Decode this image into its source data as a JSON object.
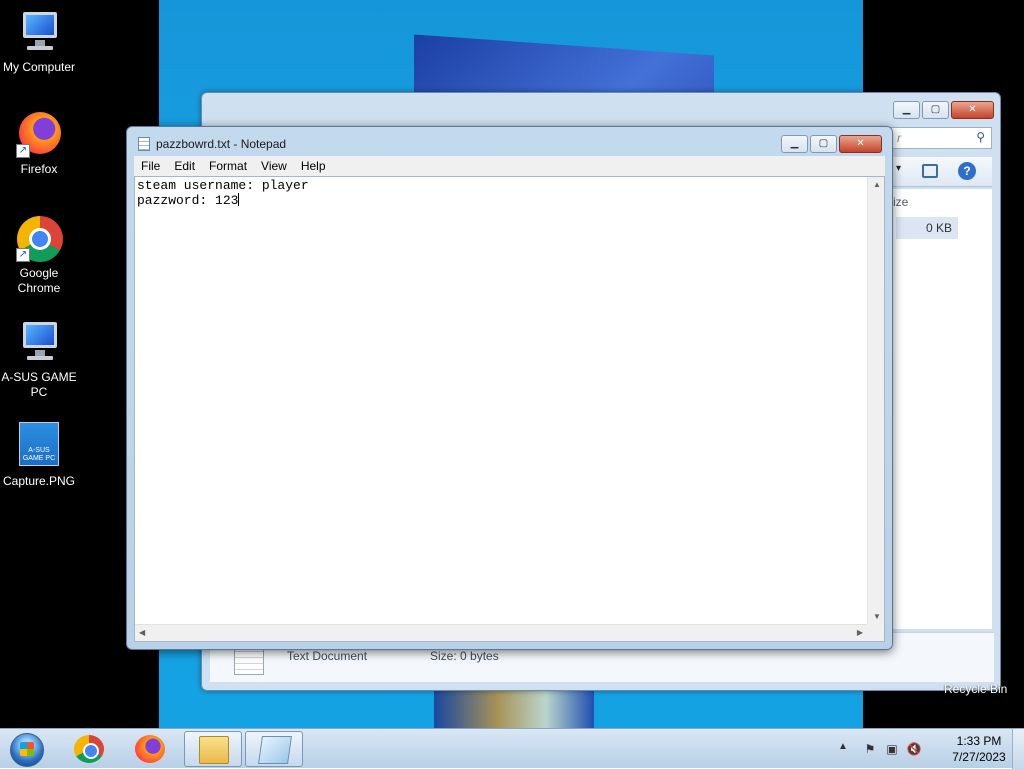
{
  "desktop": {
    "icons": [
      {
        "label_line1": "My Computer",
        "label_line2": ""
      },
      {
        "label_line1": "Firefox",
        "label_line2": ""
      },
      {
        "label_line1": "Google",
        "label_line2": "Chrome"
      },
      {
        "label_line1": "A-SUS GAME",
        "label_line2": "PC"
      },
      {
        "label_line1": "Capture.PNG",
        "label_line2": "",
        "thumb_text": "A-SUS GAME PC"
      }
    ],
    "recycle_bin_label": "Recycle Bin"
  },
  "explorer": {
    "search_placeholder_fragment": "r",
    "column_header_fragment": "ize",
    "file_size": "0 KB",
    "details": {
      "type": "Text Document",
      "size": "Size: 0 bytes"
    }
  },
  "notepad": {
    "title": "pazzbowrd.txt - Notepad",
    "menu": [
      "File",
      "Edit",
      "Format",
      "View",
      "Help"
    ],
    "lines": [
      "steam username: player",
      "pazzword: 123"
    ]
  },
  "taskbar": {
    "clock_time": "1:33 PM",
    "clock_date": "7/27/2023"
  },
  "icons": {
    "minimize": "minimize-icon",
    "maximize": "maximize-icon",
    "close": "close-icon"
  },
  "colors": {
    "wallpaper": "#18a6e8",
    "window_frame": "#c3d9ee",
    "taskbar": "#b8cfe6"
  }
}
